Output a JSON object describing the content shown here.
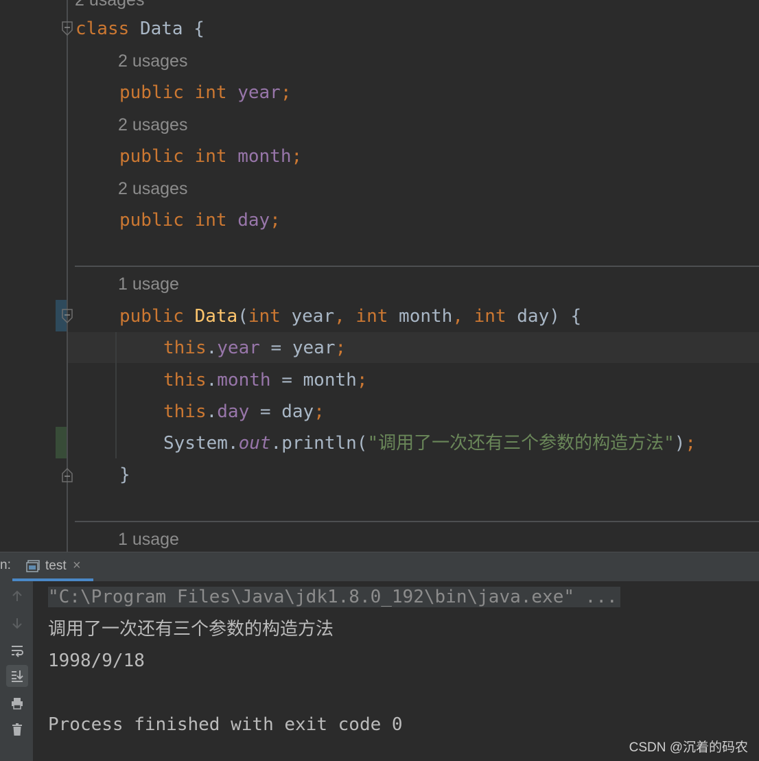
{
  "editor": {
    "top_hint": "2 usages",
    "class_line": {
      "keyword": "class",
      "name": "Data",
      "brace": "{"
    },
    "fields": [
      {
        "usage": "2 usages",
        "modifier": "public",
        "type": "int",
        "name": "year",
        "semi": ";"
      },
      {
        "usage": "2 usages",
        "modifier": "public",
        "type": "int",
        "name": "month",
        "semi": ";"
      },
      {
        "usage": "2 usages",
        "modifier": "public",
        "type": "int",
        "name": "day",
        "semi": ";"
      }
    ],
    "constructor": {
      "usage": "1 usage",
      "modifier": "public",
      "name": "Data",
      "open_paren": "(",
      "p1_type": "int",
      "p1_name": "year",
      "comma": ",",
      "p2_type": "int",
      "p2_name": "month",
      "p3_type": "int",
      "p3_name": "day",
      "close": ") {",
      "body": [
        {
          "this": "this",
          "dot": ".",
          "field": "year",
          "assign": " = ",
          "value": "year",
          "semi": ";"
        },
        {
          "this": "this",
          "dot": ".",
          "field": "month",
          "assign": " = ",
          "value": "month",
          "semi": ";"
        },
        {
          "this": "this",
          "dot": ".",
          "field": "day",
          "assign": " = ",
          "value": "day",
          "semi": ";"
        }
      ],
      "print": {
        "cls": "System",
        "dot": ".",
        "out": "out",
        "method": ".println(",
        "string": "\"调用了一次还有三个参数的构造方法\"",
        "close": ")",
        "semi": ";"
      },
      "end_brace": "}"
    },
    "bottom_hint": "1 usage"
  },
  "run_panel": {
    "label": "n:",
    "tab": {
      "name": "test",
      "close": "×"
    }
  },
  "console": {
    "lines": [
      "\"C:\\Program Files\\Java\\jdk1.8.0_192\\bin\\java.exe\" ...",
      "调用了一次还有三个参数的构造方法",
      "1998/9/18",
      "",
      "Process finished with exit code 0"
    ]
  },
  "watermark": "CSDN @沉着的码农",
  "colors": {
    "background": "#2b2b2b",
    "keyword": "#cc7832",
    "field": "#9876aa",
    "method": "#ffc66d",
    "string": "#6a8759",
    "text": "#a9b7c6",
    "hint": "#8c8c8c"
  }
}
